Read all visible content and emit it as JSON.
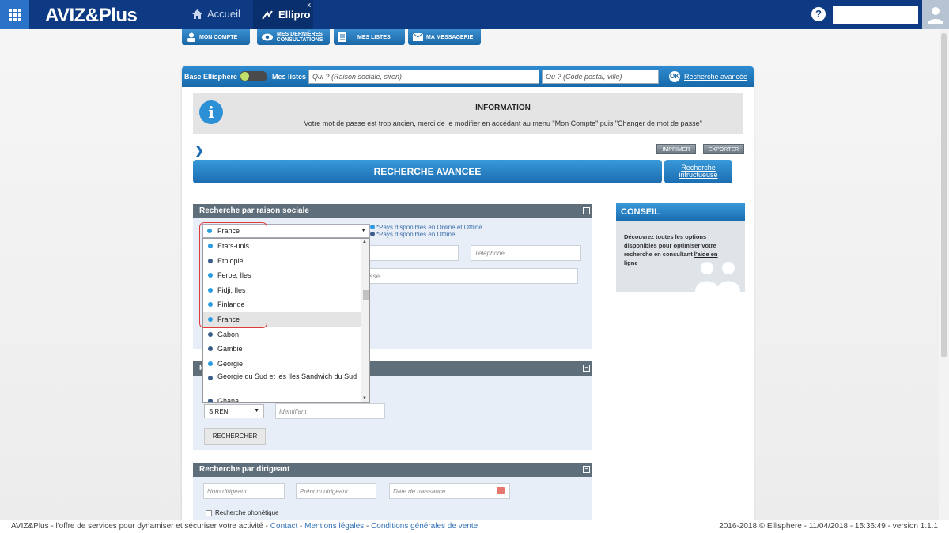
{
  "header": {
    "brand": "AVIZ&Plus",
    "nav_home": "Accueil",
    "nav_active_tab": "Ellipro",
    "close_tab": "x",
    "help": "?"
  },
  "subnav": [
    {
      "label": "MON COMPTE"
    },
    {
      "label": "MES DERNIÈRES CONSULTATIONS"
    },
    {
      "label": "MES LISTES"
    },
    {
      "label": "MA MESSAGERIE"
    }
  ],
  "searchbar": {
    "base_label": "Base Ellisphere",
    "lists_label": "Mes listes",
    "what_placeholder": "Qui ? (Raison sociale, siren)",
    "where_placeholder": "Où ? (Code postal, ville)",
    "ok": "OK",
    "advanced_link": "Recherche avancée"
  },
  "info": {
    "title": "INFORMATION",
    "message": "Votre mot de passe est trop ancien, merci de le modifier en accédant au menu \"Mon Compte\" puis \"Changer de mot de passe\""
  },
  "actions": {
    "print": "IMPRIMER",
    "export": "EXPORTER"
  },
  "advanced_search_title": "RECHERCHE AVANCEE",
  "fruitless_search_line1": "Recherche",
  "fruitless_search_line2": "infructueuse",
  "section_company": {
    "title": "Recherche par raison sociale",
    "collapse": "−",
    "legend_online": "*Pays disponibles en Online et Offline",
    "legend_offline": "*Pays disponibles en Offline",
    "phone_placeholder": "Téléphone",
    "address_placeholder_partial": "esse"
  },
  "country_select": {
    "selected": "France",
    "options": [
      {
        "name": "Etats-unis",
        "color": "#2b9be0"
      },
      {
        "name": "Ethiopie",
        "color": "#3a5d8a"
      },
      {
        "name": "Feroe, Iles",
        "color": "#2b9be0"
      },
      {
        "name": "Fidji, Iles",
        "color": "#2b9be0"
      },
      {
        "name": "Finlande",
        "color": "#2b9be0"
      },
      {
        "name": "France",
        "color": "#2b9be0"
      },
      {
        "name": "Gabon",
        "color": "#3a5d8a"
      },
      {
        "name": "Gambie",
        "color": "#3a5d8a"
      },
      {
        "name": "Georgie",
        "color": "#2b9be0"
      },
      {
        "name": "Georgie du Sud et les Iles Sandwich du Sud",
        "color": "#3a5d8a"
      },
      {
        "name": "Ghana",
        "color": "#3a5d8a"
      }
    ]
  },
  "section_id": {
    "collapse": "−",
    "id_type": "SIREN",
    "id_placeholder": "Identifiant",
    "search_button": "RECHERCHER"
  },
  "section_director": {
    "title": "Recherche par dirigeant",
    "collapse": "−",
    "lastname_placeholder": "Nom dirigeant",
    "firstname_placeholder": "Prénom dirigeant",
    "birthdate_placeholder": "Date de naissance",
    "phonetic_label": "Recherche phonétique"
  },
  "conseil": {
    "title": "CONSEIL",
    "text": "Découvrez toutes les options disponibles pour optimiser votre recherche en consultant ",
    "link": "l'aide en ligne"
  },
  "footer": {
    "text": "AVIZ&Plus - l'offre de services pour dynamiser et sécuriser votre activité - ",
    "contact": "Contact",
    "sep1": " - ",
    "legal": "Mentions légales",
    "sep2": " - ",
    "terms": "Conditions générales de vente",
    "right": "2016-2018 © Ellisphere - 11/04/2018 - 15:36:49 - version 1.1.1"
  }
}
